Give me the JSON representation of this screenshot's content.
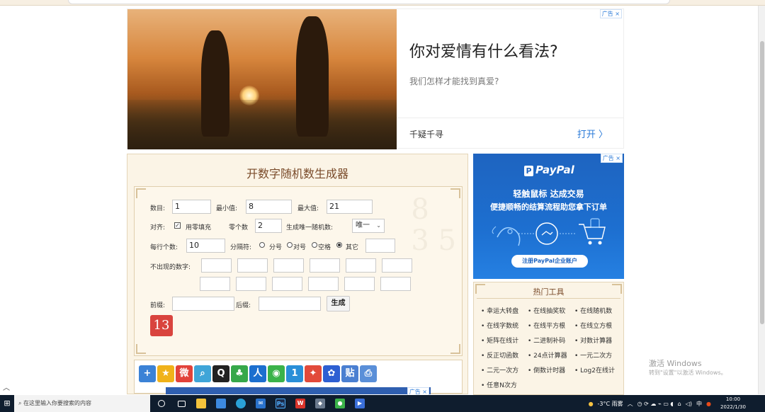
{
  "top_ad": {
    "badge": "广告",
    "close": "×",
    "question": "你对爱情有什么看法?",
    "subtitle": "我们怎样才能找到真爱?",
    "brand": "千疑千寻",
    "open_label": "打开 〉"
  },
  "tool": {
    "title": "开数字随机数生成器",
    "count_label": "数目:",
    "count_value": "1",
    "min_label": "最小值:",
    "min_value": "8",
    "max_label": "最大值:",
    "max_value": "21",
    "align_label": "对齐:",
    "zero_fill_label": "用零填充",
    "zero_count_label": "零个数",
    "zero_count_value": "2",
    "unique_label": "生成唯一随机数:",
    "unique_value": "唯一",
    "per_line_label": "每行个数:",
    "per_line_value": "10",
    "separator_label": "分隔符:",
    "sep_options": [
      "分号",
      "对号",
      "空格",
      "其它"
    ],
    "exclude_label": "不出现的数字:",
    "prefix_label": "前缀:",
    "suffix_label": "后缀:",
    "generate_label": "生成",
    "result": "13"
  },
  "share": {
    "icons": [
      "plus-icon",
      "star-icon",
      "weibo-icon",
      "search-icon",
      "qq-icon",
      "clover-icon",
      "renren-icon",
      "wechat-icon",
      "one-icon",
      "favorite-icon",
      "baidu-paw-icon",
      "tieba-icon",
      "print-icon"
    ]
  },
  "paypal_ad": {
    "logo": "PayPal",
    "line1": "轻触鼠标 达成交易",
    "line2": "便捷顺畅的结算流程助您拿下订单",
    "cta": "注册PayPal企业账户"
  },
  "hot_tools": {
    "title": "热门工具",
    "items": [
      "幸运大转盘",
      "在线抽奖软",
      "在线随机数",
      "在线字数统",
      "在线平方根",
      "在线立方根",
      "矩阵在线计",
      "二进制补码",
      "对数计算器",
      "反正切函数",
      "24点计算器",
      "一元二次方",
      "二元一次方",
      "倒数计时器",
      "Log2在线计",
      "任意N次方"
    ]
  },
  "watermark": {
    "line1": "激活 Windows",
    "line2": "转到\"设置\"以激活 Windows。"
  },
  "taskbar": {
    "search_placeholder": "在这里输入你要搜索的内容",
    "weather": "-3°C  雨雾",
    "ime": "中",
    "time": "10:00",
    "date": "2022/1/30"
  }
}
